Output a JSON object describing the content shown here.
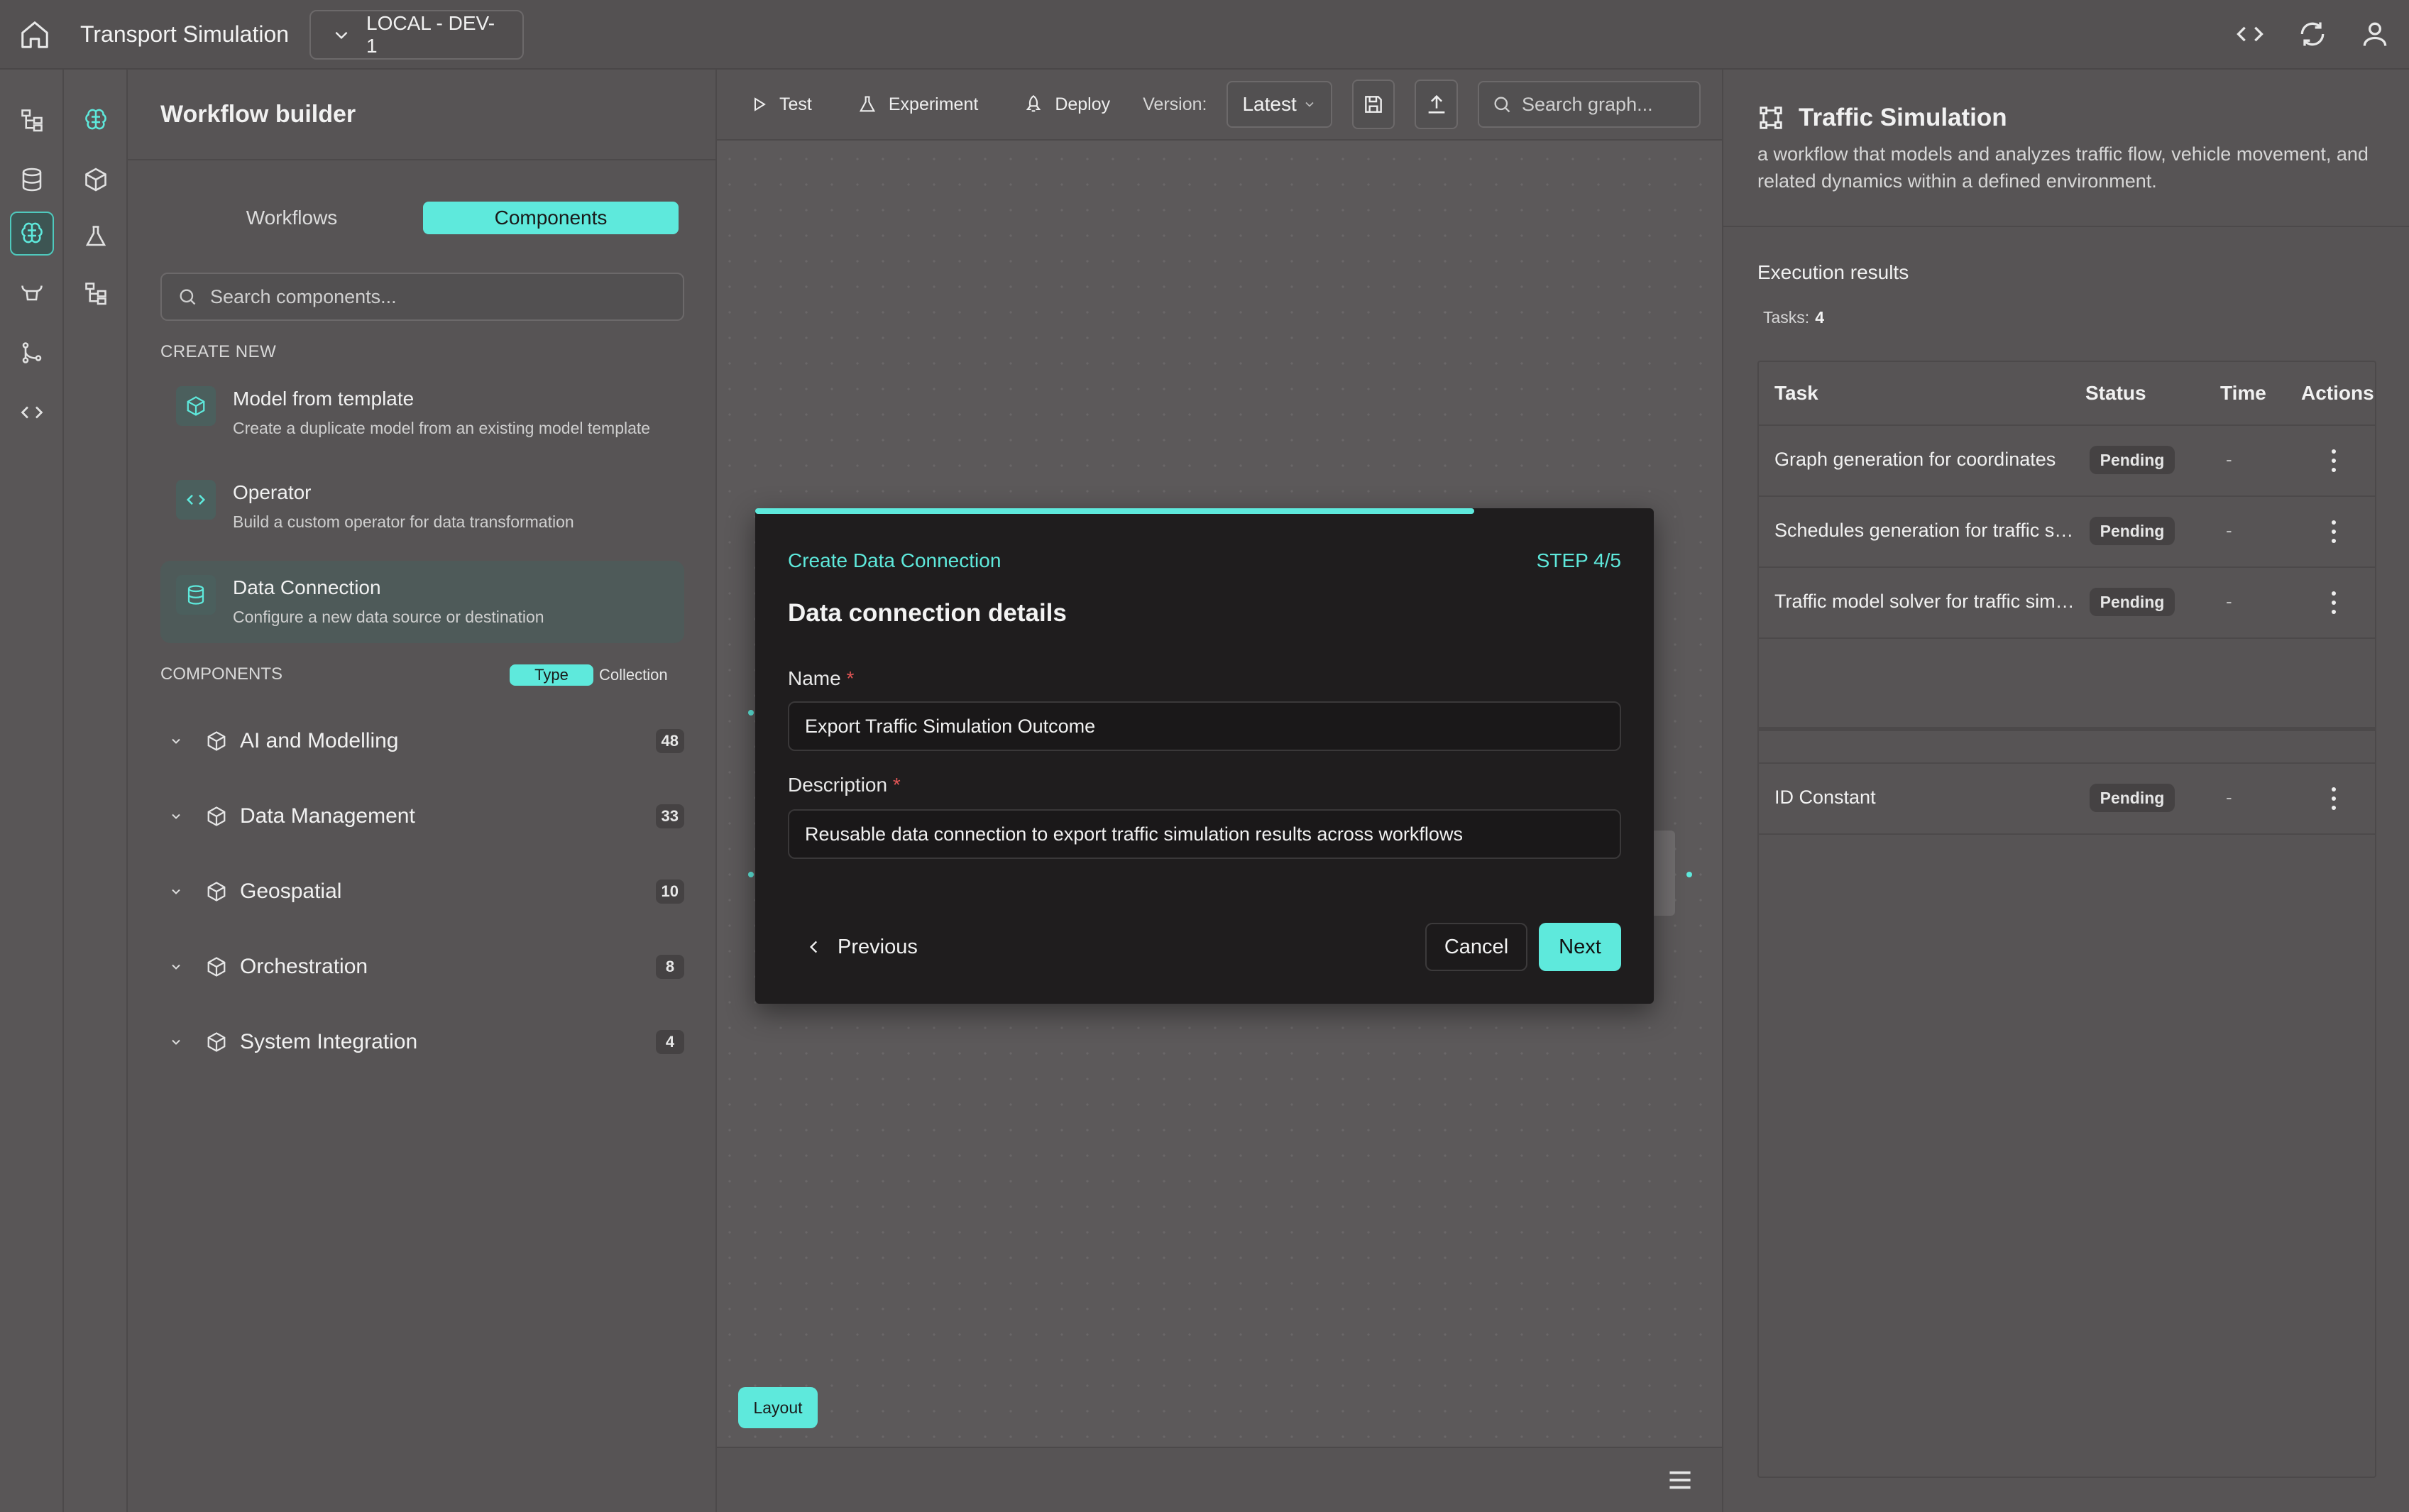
{
  "header": {
    "app_title": "Transport Simulation",
    "environment": "LOCAL - DEV-1"
  },
  "left_panel": {
    "title": "Workflow builder",
    "tabs": [
      {
        "label": "Workflows",
        "active": false
      },
      {
        "label": "Components",
        "active": true
      }
    ],
    "search_placeholder": "Search components...",
    "create_new_label": "CREATE NEW",
    "create_items": [
      {
        "title": "Model from template",
        "desc": "Create a duplicate model from an existing model template",
        "icon": "cube-icon"
      },
      {
        "title": "Operator",
        "desc": "Build a custom operator for data transformation",
        "icon": "code-icon"
      },
      {
        "title": "Data Connection",
        "desc": "Configure a new data source or destination",
        "icon": "database-icon",
        "selected": true
      }
    ],
    "components_label": "COMPONENTS",
    "filter_type": "Type",
    "filter_collection": "Collection",
    "categories": [
      {
        "label": "AI and Modelling",
        "count": "48"
      },
      {
        "label": "Data Management",
        "count": "33"
      },
      {
        "label": "Geospatial",
        "count": "10"
      },
      {
        "label": "Orchestration",
        "count": "8"
      },
      {
        "label": "System Integration",
        "count": "4"
      }
    ]
  },
  "toolbar": {
    "test": "Test",
    "experiment": "Experiment",
    "deploy": "Deploy",
    "version_label": "Version:",
    "version_value": "Latest",
    "search_placeholder": "Search graph..."
  },
  "canvas": {
    "layout_button": "Layout"
  },
  "modal": {
    "subtitle": "Create Data Connection",
    "step": "STEP 4/5",
    "progress": 0.8,
    "title": "Data connection details",
    "name_label": "Name",
    "name_value": "Export Traffic Simulation Outcome",
    "desc_label": "Description",
    "desc_value": "Reusable data connection to export traffic simulation results across workflows",
    "required_mark": "*",
    "prev": "Previous",
    "cancel": "Cancel",
    "next": "Next"
  },
  "right_panel": {
    "title": "Traffic Simulation",
    "description": "a workflow that models and analyzes traffic flow, vehicle movement, and related dynamics within a defined environment.",
    "exec_title": "Execution results",
    "tasks_label": "Tasks:",
    "tasks_count": "4",
    "columns": [
      "Task",
      "Status",
      "Time",
      "Actions"
    ],
    "rows": [
      {
        "task": "Graph generation for coordinates",
        "status": "Pending",
        "time": "-"
      },
      {
        "task": "Schedules generation for traffic s…",
        "status": "Pending",
        "time": "-"
      },
      {
        "task": "Traffic model solver for traffic sim…",
        "status": "Pending",
        "time": "-"
      },
      {
        "task": "ID Constant",
        "status": "Pending",
        "time": "-"
      }
    ]
  },
  "colors": {
    "accent": "#5ee9dc",
    "modal_bg": "#1f1d1e",
    "required": "#e05555"
  }
}
